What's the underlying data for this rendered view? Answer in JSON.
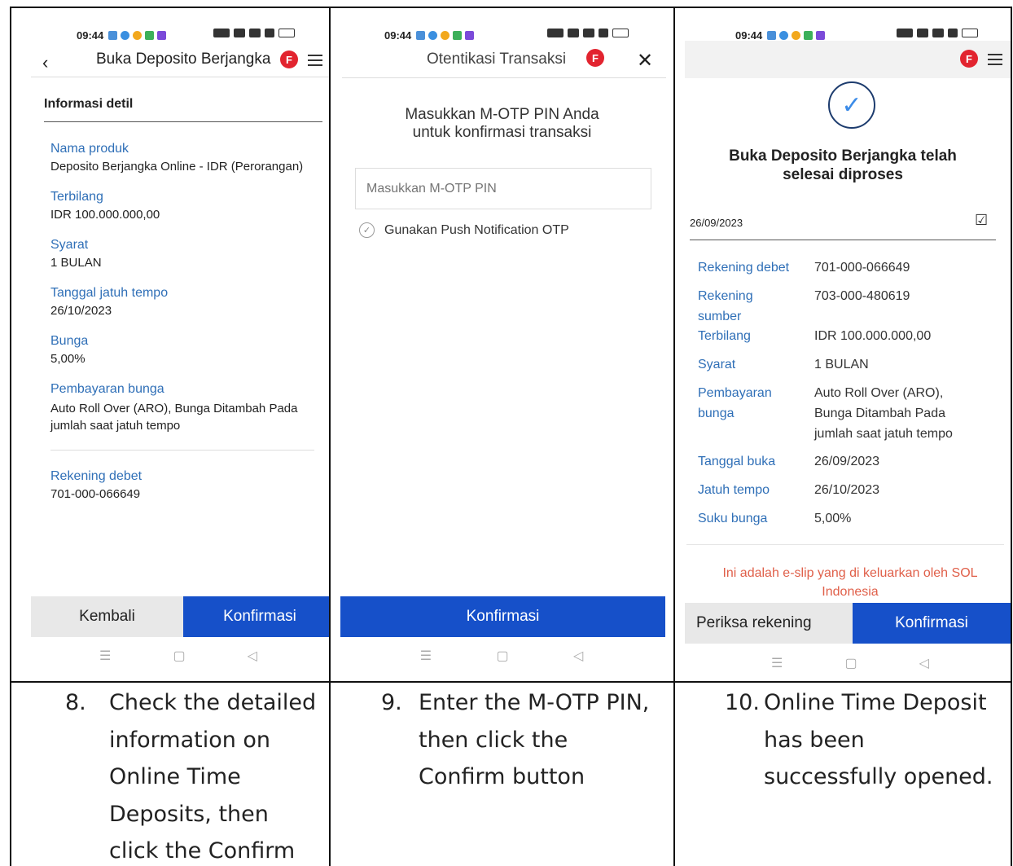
{
  "screens": [
    {
      "status_time": "09:44",
      "title": "Buka Deposito Berjangka",
      "badge": "F",
      "section_title": "Informasi detil",
      "fields": [
        {
          "label": "Nama produk",
          "value": "Deposito Berjangka Online - IDR (Perorangan)"
        },
        {
          "label": "Terbilang",
          "value": "IDR 100.000.000,00"
        },
        {
          "label": "Syarat",
          "value": "1 BULAN"
        },
        {
          "label": "Tanggal jatuh tempo",
          "value": "26/10/2023"
        },
        {
          "label": "Bunga",
          "value": "5,00%"
        },
        {
          "label": "Pembayaran bunga",
          "value": "Auto Roll Over (ARO), Bunga Ditambah Pada jumlah saat jatuh tempo"
        }
      ],
      "debit_label": "Rekening debet",
      "debit_value": "701-000-066649",
      "back_button": "Kembali",
      "confirm_button": "Konfirmasi"
    },
    {
      "status_time": "09:44",
      "title": "Otentikasi Transaksi",
      "badge": "F",
      "heading_line1": "Masukkan M-OTP PIN Anda",
      "heading_line2": "untuk konfirmasi transaksi",
      "pin_placeholder": "Masukkan M-OTP PIN",
      "push_option": "Gunakan Push Notification OTP",
      "confirm_button": "Konfirmasi"
    },
    {
      "status_time": "09:44",
      "badge": "F",
      "heading_line1": "Buka Deposito Berjangka telah",
      "heading_line2": "selesai diproses",
      "date": "26/09/2023",
      "rows": [
        {
          "label": "Rekening debet",
          "value": "701-000-066649"
        },
        {
          "label": "Rekening sumber",
          "value": "703-000-480619"
        },
        {
          "label": "Terbilang",
          "value": "IDR 100.000.000,00"
        },
        {
          "label": "Syarat",
          "value": "1 BULAN"
        },
        {
          "label": "Pembayaran bunga",
          "value": "Auto Roll Over (ARO), Bunga Ditambah Pada jumlah saat jatuh tempo"
        },
        {
          "label": "Tanggal buka",
          "value": "26/09/2023"
        },
        {
          "label": "Jatuh tempo",
          "value": "26/10/2023"
        },
        {
          "label": "Suku bunga",
          "value": "5,00%"
        }
      ],
      "eslip_note": "Ini adalah e-slip yang di keluarkan oleh SOL Indonesia",
      "check_account_button": "Periksa rekening",
      "confirm_button": "Konfirmasi"
    }
  ],
  "captions": [
    {
      "number": "8.",
      "text": "Check the detailed information on Online Time Deposits, then click the Confirm button"
    },
    {
      "number": "9.",
      "text": "Enter the M-OTP PIN, then click the Confirm button"
    },
    {
      "number": "10.",
      "text": "Online Time Deposit has been successfully opened."
    }
  ]
}
